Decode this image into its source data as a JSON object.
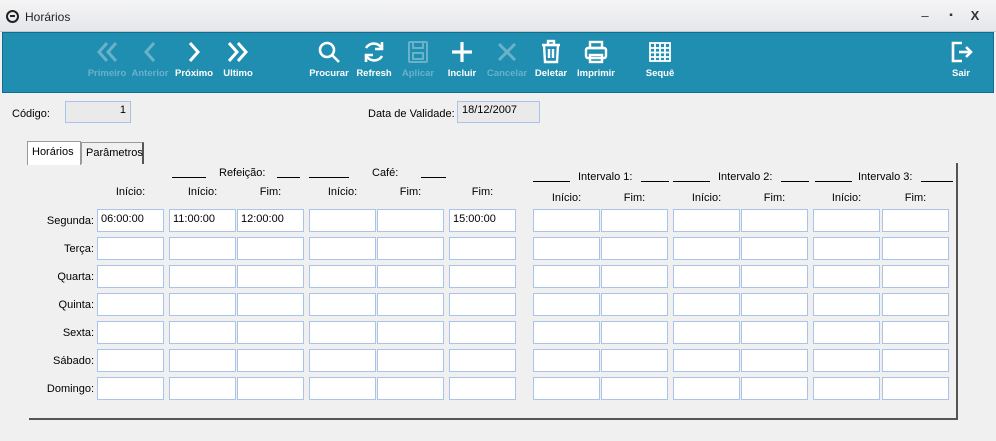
{
  "window": {
    "title": "Horários",
    "minimize": "‒",
    "maximize": "▪",
    "close": "X"
  },
  "toolbar": {
    "primeiro": "Primeiro",
    "anterior": "Anterior",
    "proximo": "Próximo",
    "ultimo": "Ultimo",
    "procurar": "Procurar",
    "refresh": "Refresh",
    "aplicar": "Aplicar",
    "incluir": "Incluir",
    "cancelar": "Cancelar",
    "deletar": "Deletar",
    "imprimir": "Imprimir",
    "seque": "Sequê",
    "sair": "Sair"
  },
  "form": {
    "codigo_label": "Código:",
    "codigo_value": "1",
    "validade_label": "Data de Validade:",
    "validade_value": "18/12/2007"
  },
  "tabs": {
    "horarios": "Horários",
    "parametros": "Parâmetros"
  },
  "groups": {
    "refeicao": "Refeição:",
    "cafe": "Café:",
    "intervalo1": "Intervalo 1:",
    "intervalo2": "Intervalo 2:",
    "intervalo3": "Intervalo 3:"
  },
  "headers": [
    "Início:",
    "Início:",
    "Fim:",
    "Início:",
    "Fim:",
    "Fim:",
    "Início:",
    "Fim:",
    "Início:",
    "Fim:",
    "Início:",
    "Fim:"
  ],
  "days": [
    "Segunda:",
    "Terça:",
    "Quarta:",
    "Quinta:",
    "Sexta:",
    "Sábado:",
    "Domingo:"
  ],
  "schedule": [
    [
      "06:00:00",
      "11:00:00",
      "12:00:00",
      "",
      "",
      "15:00:00",
      "",
      "",
      "",
      "",
      "",
      ""
    ],
    [
      "",
      "",
      "",
      "",
      "",
      "",
      "",
      "",
      "",
      "",
      "",
      ""
    ],
    [
      "",
      "",
      "",
      "",
      "",
      "",
      "",
      "",
      "",
      "",
      "",
      ""
    ],
    [
      "",
      "",
      "",
      "",
      "",
      "",
      "",
      "",
      "",
      "",
      "",
      ""
    ],
    [
      "",
      "",
      "",
      "",
      "",
      "",
      "",
      "",
      "",
      "",
      "",
      ""
    ],
    [
      "",
      "",
      "",
      "",
      "",
      "",
      "",
      "",
      "",
      "",
      "",
      ""
    ],
    [
      "",
      "",
      "",
      "",
      "",
      "",
      "",
      "",
      "",
      "",
      "",
      ""
    ]
  ]
}
